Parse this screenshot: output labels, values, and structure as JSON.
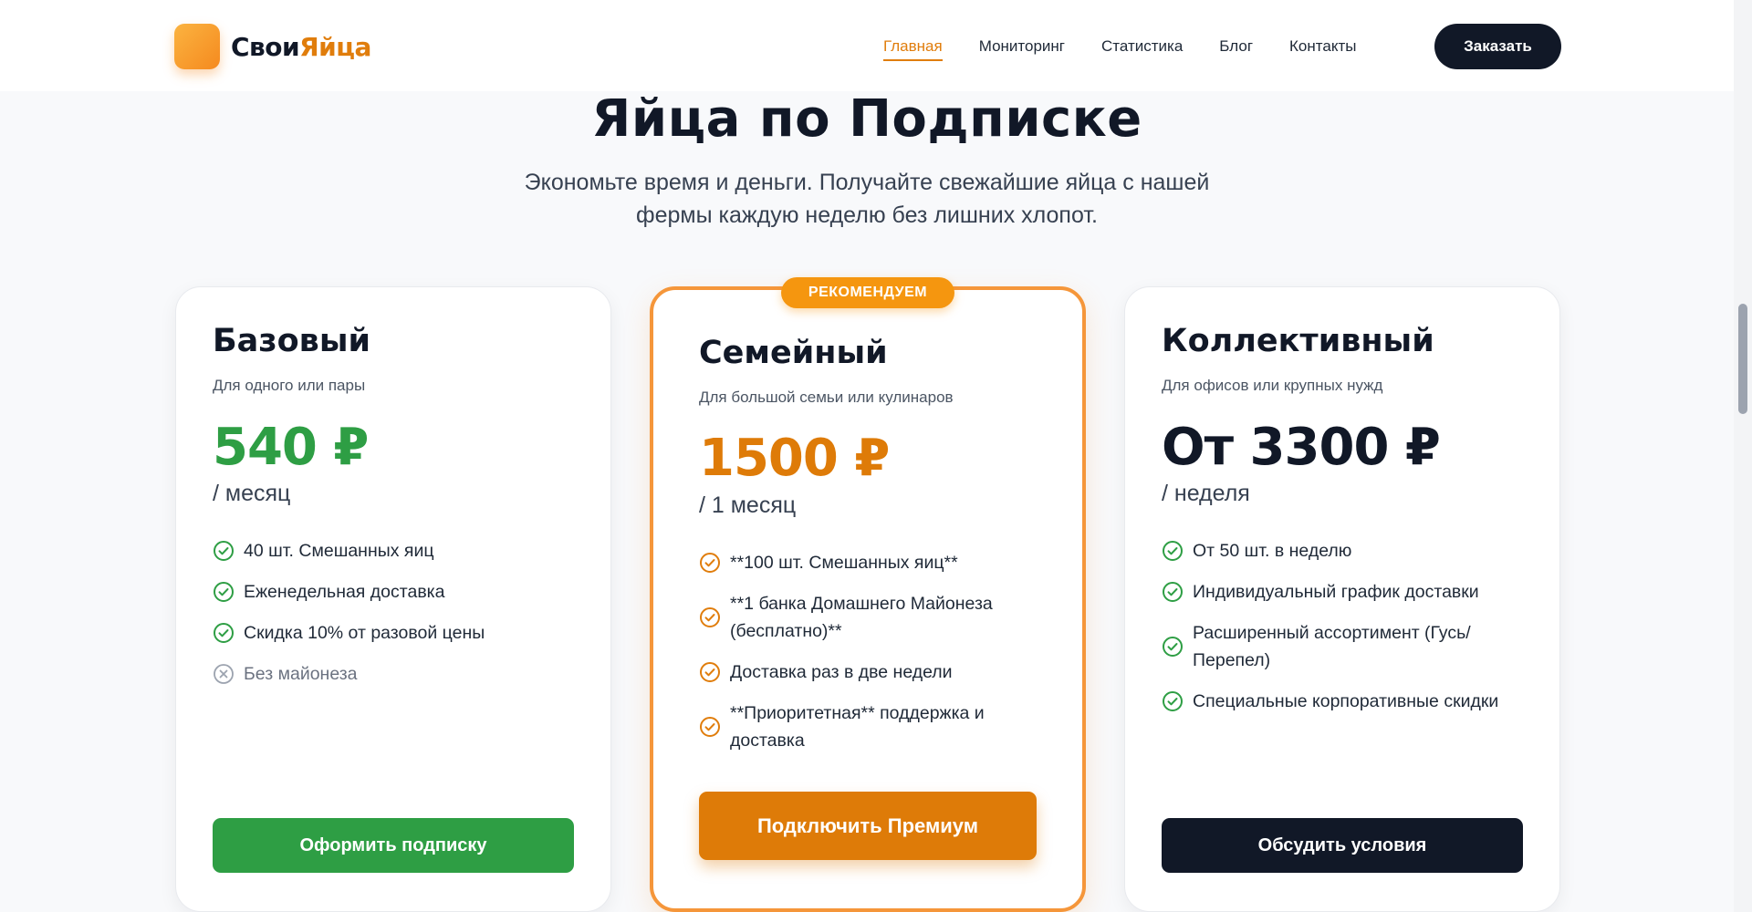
{
  "header": {
    "logo_part1": "Свои",
    "logo_part2": "Яйца",
    "nav": [
      {
        "label": "Главная",
        "active": true
      },
      {
        "label": "Мониторинг",
        "active": false
      },
      {
        "label": "Статистика",
        "active": false
      },
      {
        "label": "Блог",
        "active": false
      },
      {
        "label": "Контакты",
        "active": false
      }
    ],
    "order_label": "Заказать"
  },
  "hero": {
    "title": "Яйца по Подписке",
    "subtitle": "Экономьте время и деньги. Получайте свежайшие яйца с нашей фермы каждую неделю без лишних хлопот."
  },
  "plans": [
    {
      "name": "Базовый",
      "desc": "Для одного или пары",
      "price": "540 ₽",
      "period": "/ месяц",
      "price_color": "#2e9e44",
      "features": [
        {
          "text": "40 шт. Смешанных яиц",
          "included": true
        },
        {
          "text": "Еженедельная доставка",
          "included": true
        },
        {
          "text": "Скидка 10% от разовой цены",
          "included": true
        },
        {
          "text": "Без майонеза",
          "included": false
        }
      ],
      "cta": "Оформить подписку"
    },
    {
      "badge": "РЕКОМЕНДУЕМ",
      "name": "Семейный",
      "desc": "Для большой семьи или кулинаров",
      "price": "1500 ₽",
      "period": "/ 1 месяц",
      "price_color": "#de7b08",
      "features": [
        {
          "text": "**100 шт. Смешанных яиц**",
          "included": true
        },
        {
          "text": "**1 банка Домашнего Майонеза (бесплатно)**",
          "included": true
        },
        {
          "text": "Доставка раз в две недели",
          "included": true
        },
        {
          "text": "**Приоритетная** поддержка и доставка",
          "included": true
        }
      ],
      "cta": "Подключить Премиум"
    },
    {
      "name": "Коллективный",
      "desc": "Для офисов или крупных нужд",
      "price": "От 3300 ₽",
      "period": "/ неделя",
      "price_color": "#111827",
      "features": [
        {
          "text": "От 50 шт. в неделю",
          "included": true
        },
        {
          "text": "Индивидуальный график доставки",
          "included": true
        },
        {
          "text": "Расширенный ассортимент (Гусь/Перепел)",
          "included": true
        },
        {
          "text": "Специальные корпоративные скидки",
          "included": true
        }
      ],
      "cta": "Обсудить условия"
    }
  ],
  "colors": {
    "accent_orange": "#e07d0c",
    "green": "#2e9e44",
    "dark": "#111827",
    "check_green": "#2e9e44",
    "check_orange": "#e07d0c",
    "muted": "#9ca3af"
  }
}
